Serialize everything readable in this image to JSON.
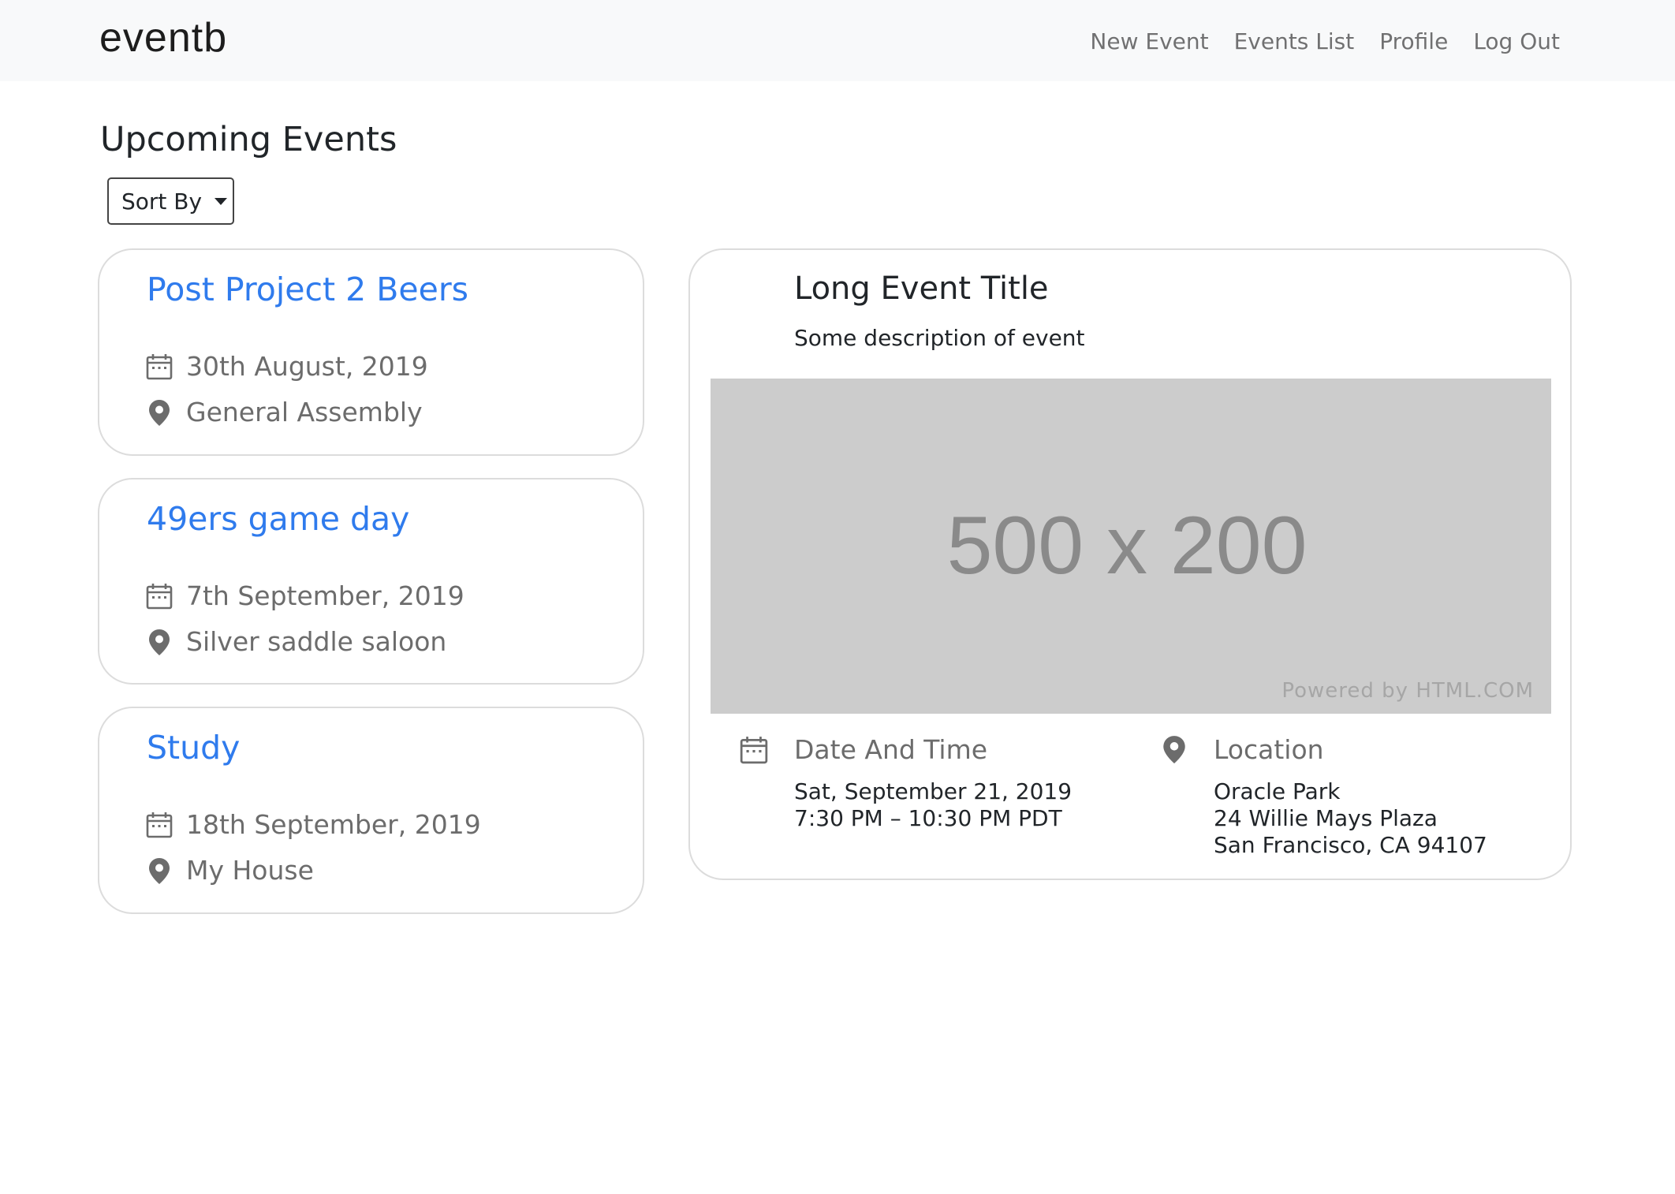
{
  "navbar": {
    "brand": "eventb",
    "links": [
      "New Event",
      "Events List",
      "Profile",
      "Log Out"
    ]
  },
  "page": {
    "title": "Upcoming Events",
    "sort_label": "Sort By"
  },
  "events": [
    {
      "title": "Post Project 2 Beers",
      "date": "30th August, 2019",
      "location": "General Assembly"
    },
    {
      "title": "49ers game day",
      "date": "7th September, 2019",
      "location": "Silver saddle saloon"
    },
    {
      "title": "Study",
      "date": "18th September, 2019",
      "location": "My House"
    }
  ],
  "detail": {
    "title": "Long Event Title",
    "description": "Some description of event",
    "image": {
      "size_text": "500 x 200",
      "powered_text": "Powered by HTML.COM"
    },
    "datetime_heading": "Date And Time",
    "datetime_lines": [
      "Sat, September 21, 2019",
      "7:30 PM – 10:30 PM PDT"
    ],
    "location_heading": "Location",
    "location_lines": [
      "Oracle Park",
      "24 Willie Mays Plaza",
      "San Francisco, CA 94107"
    ]
  },
  "colors": {
    "link_blue": "#2f7bed",
    "muted_gray": "#6c6c6c",
    "navbar_bg": "#f8f9fa",
    "placeholder_bg": "#cccccc"
  },
  "icons": {
    "date": "calendar-icon",
    "location": "map-pin-icon",
    "sort": "caret-down-icon"
  }
}
